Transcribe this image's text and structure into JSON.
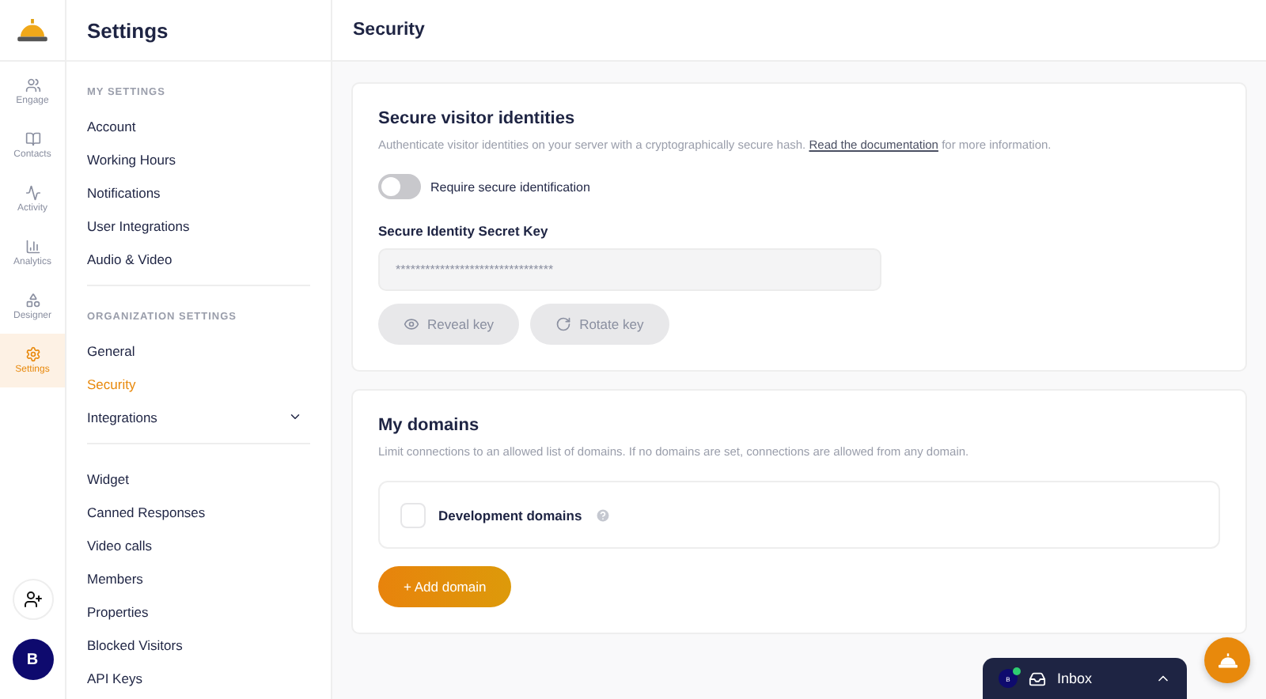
{
  "rail": {
    "items": [
      {
        "label": "Engage",
        "selected": false
      },
      {
        "label": "Contacts",
        "selected": false
      },
      {
        "label": "Activity",
        "selected": false
      },
      {
        "label": "Analytics",
        "selected": false
      },
      {
        "label": "Designer",
        "selected": false
      },
      {
        "label": "Settings",
        "selected": true
      }
    ],
    "avatar": "B"
  },
  "sidebar": {
    "title": "Settings",
    "sections": [
      {
        "heading": "MY SETTINGS",
        "items": [
          {
            "label": "Account",
            "selected": false
          },
          {
            "label": "Working Hours",
            "selected": false
          },
          {
            "label": "Notifications",
            "selected": false
          },
          {
            "label": "User Integrations",
            "selected": false
          },
          {
            "label": "Audio & Video",
            "selected": false
          }
        ]
      },
      {
        "heading": "ORGANIZATION SETTINGS",
        "items": [
          {
            "label": "General",
            "selected": false
          },
          {
            "label": "Security",
            "selected": true
          },
          {
            "label": "Integrations",
            "selected": false,
            "expanded": false
          }
        ]
      },
      {
        "items": [
          {
            "label": "Widget",
            "selected": false
          },
          {
            "label": "Canned Responses",
            "selected": false
          },
          {
            "label": "Video calls",
            "selected": false
          },
          {
            "label": "Members",
            "selected": false
          },
          {
            "label": "Properties",
            "selected": false
          },
          {
            "label": "Blocked Visitors",
            "selected": false
          },
          {
            "label": "API Keys",
            "selected": false
          }
        ]
      }
    ]
  },
  "page": {
    "title": "Security"
  },
  "identity_card": {
    "title": "Secure visitor identities",
    "description": "Authenticate visitor identities on your server with a cryptographically secure hash.",
    "link": "Read the documentation",
    "description_end": "for more information.",
    "toggle": {
      "label": "Require secure identification",
      "on": false
    },
    "key_label": "Secure Identity Secret Key",
    "key_value": "********************************",
    "buttons": [
      "Reveal key",
      "Rotate key"
    ]
  },
  "domains_card": {
    "title": "My domains",
    "description": "Limit connections to an allowed list of domains. If no domains are set, connections are allowed from any domain.",
    "option": {
      "label": "Development domains",
      "checked": false
    },
    "add_button": "+ Add domain"
  },
  "inbox_widget": {
    "avatar": "B",
    "label": "Inbox",
    "expanded": false
  }
}
